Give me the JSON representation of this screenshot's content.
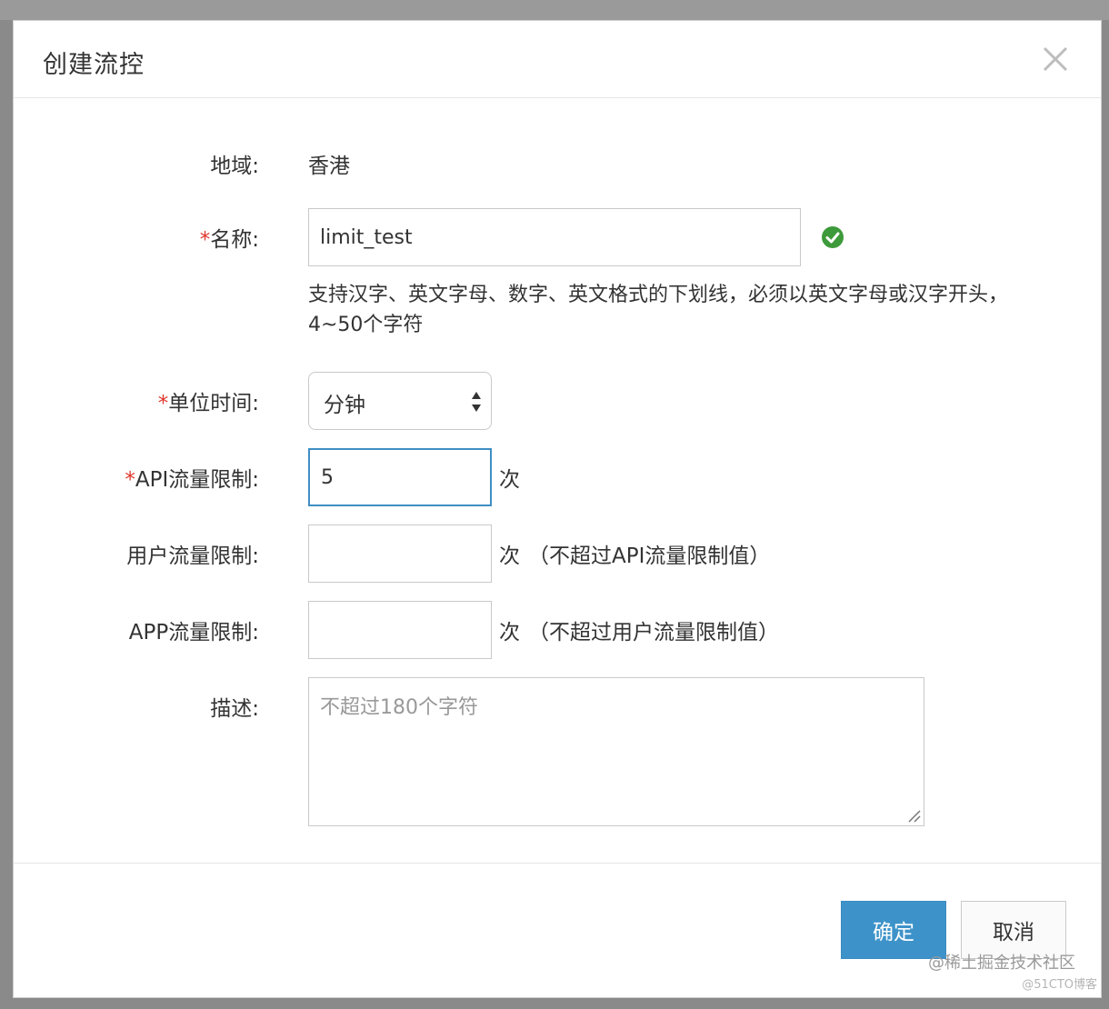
{
  "dialog": {
    "title": "创建流控",
    "close_icon": "close-icon"
  },
  "form": {
    "region": {
      "label": "地域:",
      "value": "香港"
    },
    "name": {
      "required_mark": "*",
      "label": "名称:",
      "value": "limit_test",
      "valid_icon": "check-circle-icon",
      "valid_color": "#3d9a3a",
      "help": "支持汉字、英文字母、数字、英文格式的下划线，必须以英文字母或汉字开头，4~50个字符"
    },
    "unit_time": {
      "required_mark": "*",
      "label": "单位时间:",
      "selected": "分钟"
    },
    "api_limit": {
      "required_mark": "*",
      "label": "API流量限制:",
      "value": "5",
      "unit": "次"
    },
    "user_limit": {
      "label": "用户流量限制:",
      "value": "",
      "unit": "次",
      "note": "（不超过API流量限制值）"
    },
    "app_limit": {
      "label": "APP流量限制:",
      "value": "",
      "unit": "次",
      "note": "（不超过用户流量限制值）"
    },
    "description": {
      "label": "描述:",
      "placeholder": "不超过180个字符"
    }
  },
  "footer": {
    "confirm_label": "确定",
    "cancel_label": "取消"
  },
  "watermark": {
    "text": "@稀土掘金技术社区",
    "sub": "@51CTO博客"
  },
  "colors": {
    "primary": "#3d93c9",
    "required": "#e0362b",
    "focus_border": "#3f8ec5"
  }
}
